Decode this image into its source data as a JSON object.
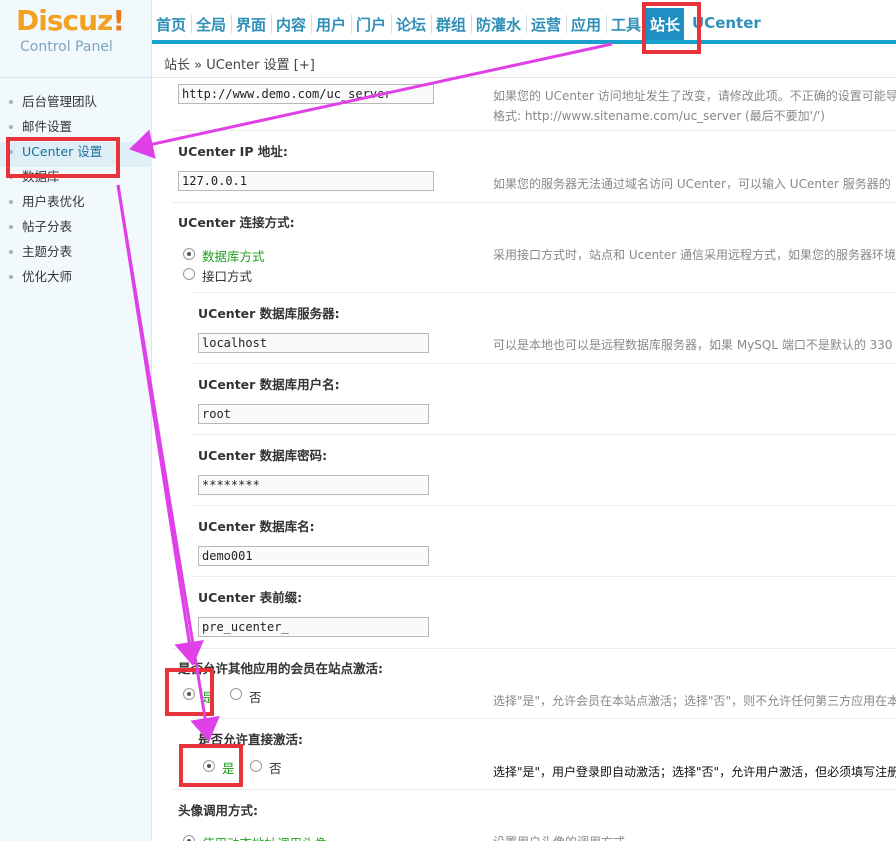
{
  "logo": {
    "brand": "Discuz",
    "bang": "!",
    "subtitle": "Control Panel"
  },
  "topnav": [
    "首页",
    "全局",
    "界面",
    "内容",
    "用户",
    "门户",
    "论坛",
    "群组",
    "防灌水",
    "运营",
    "应用",
    "工具",
    "站长",
    "UCenter"
  ],
  "topnav_active": "站长",
  "breadcrumb": "站长 » UCenter 设置  [+]",
  "sidebar": {
    "items": [
      "后台管理团队",
      "邮件设置",
      "UCenter 设置",
      "数据库",
      "用户表优化",
      "帖子分表",
      "主题分表",
      "优化大师"
    ],
    "current": "UCenter 设置"
  },
  "form": {
    "uc_url": {
      "value": "http://www.demo.com/uc_server",
      "tip1": "如果您的 UCenter 访问地址发生了改变，请修改此项。不正确的设置可能导",
      "tip2": "格式: http://www.sitename.com/uc_server (最后不要加'/')"
    },
    "uc_ip": {
      "label": "UCenter IP 地址:",
      "value": "127.0.0.1",
      "tip": "如果您的服务器无法通过域名访问 UCenter，可以输入 UCenter 服务器的"
    },
    "uc_connect": {
      "label": "UCenter 连接方式:",
      "opt_db": "数据库方式",
      "opt_api": "接口方式",
      "tip": "采用接口方式时，站点和 Ucenter 通信采用远程方式，如果您的服务器环境"
    },
    "db_host": {
      "label": "UCenter 数据库服务器:",
      "value": "localhost",
      "tip": "可以是本地也可以是远程数据库服务器，如果 MySQL 端口不是默认的 330"
    },
    "db_user": {
      "label": "UCenter 数据库用户名:",
      "value": "root"
    },
    "db_pass": {
      "label": "UCenter 数据库密码:",
      "value": "********"
    },
    "db_name": {
      "label": "UCenter 数据库名:",
      "value": "demo001"
    },
    "db_prefix": {
      "label": "UCenter 表前缀:",
      "value": "pre_ucenter_"
    },
    "allow_activate": {
      "label": "是否允许其他应用的会员在站点激活:",
      "yes": "是",
      "no": "否",
      "tip": "选择\"是\"，允许会员在本站点激活；选择\"否\"，则不允许任何第三方应用在本"
    },
    "direct_activate": {
      "label": "是否允许直接激活:",
      "yes": "是",
      "no": "否",
      "tip": "选择\"是\"，用户登录即自动激活；选择\"否\"，允许用户激活，但必须填写注册"
    },
    "avatar": {
      "label": "头像调用方式:",
      "opt": "使用动态地址调用头像",
      "tip": "设置用户头像的调用方式"
    }
  },
  "colors": {
    "accent": "#1e8ec4",
    "highlight": "#e8333a",
    "arrow": "#e040e8",
    "green": "#1e9e1e"
  }
}
